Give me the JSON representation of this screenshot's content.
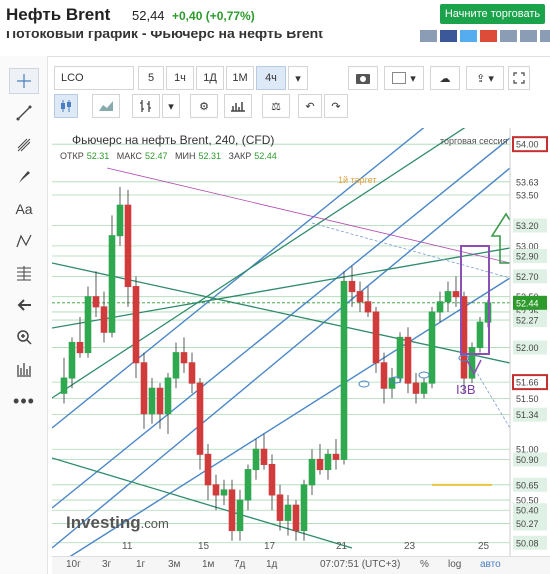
{
  "header": {
    "title": "Нефть Brent",
    "price": "52,44",
    "change": "+0,40 (+0,77%)",
    "trade_button": "Начните торговать",
    "subtitle": "Потоковый график - Фьючерс на нефть Brent"
  },
  "toolbar": {
    "symbol": "LCO",
    "intervals": [
      "5",
      "1ч",
      "1Д",
      "1М",
      "4ч"
    ],
    "selected_interval": "4ч"
  },
  "chart": {
    "legend_title": "Фьючерс на нефть Brent, 240, (CFD)",
    "session_label": "торговая сессия",
    "ohlc": {
      "open_label": "ОТКР",
      "open": "52.31",
      "high_label": "МАКС",
      "high": "52.47",
      "low_label": "МИН",
      "low": "52.31",
      "close_label": "ЗАКР",
      "close": "52.44"
    },
    "target_label": "1й таргет",
    "wave_label": "I3B",
    "watermark": "Investing",
    "watermark_suffix": ".com",
    "current_price_tag": "52.44",
    "boxed_levels": [
      "54.00",
      "51.66"
    ],
    "highlight_levels": [
      "53.20",
      "52.90",
      "52.70",
      "52.35",
      "52.27",
      "52.00",
      "51.34",
      "50.90",
      "50.65",
      "50.40",
      "50.27",
      "50.08"
    ],
    "plain_ticks": [
      "53.63",
      "53.50",
      "53.00",
      "52.50",
      "51.50",
      "51.00",
      "50.50"
    ]
  },
  "chart_data": {
    "type": "candlestick",
    "ylim": [
      49.95,
      54.1
    ],
    "candles": [
      {
        "o": 51.55,
        "h": 51.9,
        "l": 51.45,
        "c": 51.7
      },
      {
        "o": 51.7,
        "h": 52.1,
        "l": 51.6,
        "c": 52.05
      },
      {
        "o": 52.05,
        "h": 52.3,
        "l": 51.9,
        "c": 51.95
      },
      {
        "o": 51.95,
        "h": 52.6,
        "l": 51.9,
        "c": 52.5
      },
      {
        "o": 52.5,
        "h": 52.75,
        "l": 52.3,
        "c": 52.4
      },
      {
        "o": 52.4,
        "h": 52.55,
        "l": 52.05,
        "c": 52.15
      },
      {
        "o": 52.15,
        "h": 53.3,
        "l": 52.1,
        "c": 53.1
      },
      {
        "o": 53.1,
        "h": 53.58,
        "l": 53.0,
        "c": 53.4
      },
      {
        "o": 53.4,
        "h": 53.55,
        "l": 52.4,
        "c": 52.6
      },
      {
        "o": 52.6,
        "h": 52.7,
        "l": 51.7,
        "c": 51.85
      },
      {
        "o": 51.85,
        "h": 51.95,
        "l": 51.2,
        "c": 51.35
      },
      {
        "o": 51.35,
        "h": 51.7,
        "l": 51.25,
        "c": 51.6
      },
      {
        "o": 51.6,
        "h": 51.65,
        "l": 51.2,
        "c": 51.35
      },
      {
        "o": 51.35,
        "h": 51.75,
        "l": 51.15,
        "c": 51.7
      },
      {
        "o": 51.7,
        "h": 52.05,
        "l": 51.6,
        "c": 51.95
      },
      {
        "o": 51.95,
        "h": 52.1,
        "l": 51.75,
        "c": 51.85
      },
      {
        "o": 51.85,
        "h": 51.95,
        "l": 51.55,
        "c": 51.65
      },
      {
        "o": 51.65,
        "h": 51.7,
        "l": 50.8,
        "c": 50.95
      },
      {
        "o": 50.95,
        "h": 51.05,
        "l": 50.5,
        "c": 50.65
      },
      {
        "o": 50.65,
        "h": 50.75,
        "l": 50.4,
        "c": 50.55
      },
      {
        "o": 50.55,
        "h": 50.7,
        "l": 50.45,
        "c": 50.6
      },
      {
        "o": 50.6,
        "h": 50.7,
        "l": 50.1,
        "c": 50.2
      },
      {
        "o": 50.2,
        "h": 50.6,
        "l": 50.1,
        "c": 50.5
      },
      {
        "o": 50.5,
        "h": 50.85,
        "l": 50.4,
        "c": 50.8
      },
      {
        "o": 50.8,
        "h": 51.1,
        "l": 50.7,
        "c": 51.0
      },
      {
        "o": 51.0,
        "h": 51.15,
        "l": 50.8,
        "c": 50.85
      },
      {
        "o": 50.85,
        "h": 50.95,
        "l": 50.4,
        "c": 50.55
      },
      {
        "o": 50.55,
        "h": 50.65,
        "l": 50.2,
        "c": 50.3
      },
      {
        "o": 50.3,
        "h": 50.55,
        "l": 50.15,
        "c": 50.45
      },
      {
        "o": 50.45,
        "h": 50.5,
        "l": 50.1,
        "c": 50.2
      },
      {
        "o": 50.2,
        "h": 50.7,
        "l": 50.1,
        "c": 50.65
      },
      {
        "o": 50.65,
        "h": 51.0,
        "l": 50.55,
        "c": 50.9
      },
      {
        "o": 50.9,
        "h": 51.05,
        "l": 50.75,
        "c": 50.8
      },
      {
        "o": 50.8,
        "h": 51.0,
        "l": 50.7,
        "c": 50.95
      },
      {
        "o": 50.95,
        "h": 51.1,
        "l": 50.8,
        "c": 50.9
      },
      {
        "o": 50.9,
        "h": 52.75,
        "l": 50.85,
        "c": 52.65
      },
      {
        "o": 52.65,
        "h": 52.8,
        "l": 52.4,
        "c": 52.55
      },
      {
        "o": 52.55,
        "h": 52.65,
        "l": 52.35,
        "c": 52.45
      },
      {
        "o": 52.45,
        "h": 52.6,
        "l": 52.3,
        "c": 52.35
      },
      {
        "o": 52.35,
        "h": 52.4,
        "l": 51.75,
        "c": 51.85
      },
      {
        "o": 51.85,
        "h": 51.95,
        "l": 51.45,
        "c": 51.6
      },
      {
        "o": 51.6,
        "h": 51.8,
        "l": 51.5,
        "c": 51.7
      },
      {
        "o": 51.7,
        "h": 52.15,
        "l": 51.65,
        "c": 52.1
      },
      {
        "o": 52.1,
        "h": 52.2,
        "l": 51.55,
        "c": 51.65
      },
      {
        "o": 51.65,
        "h": 51.75,
        "l": 51.45,
        "c": 51.55
      },
      {
        "o": 51.55,
        "h": 51.7,
        "l": 51.5,
        "c": 51.65
      },
      {
        "o": 51.65,
        "h": 52.4,
        "l": 51.6,
        "c": 52.35
      },
      {
        "o": 52.35,
        "h": 52.55,
        "l": 52.25,
        "c": 52.45
      },
      {
        "o": 52.45,
        "h": 52.65,
        "l": 52.35,
        "c": 52.55
      },
      {
        "o": 52.55,
        "h": 52.7,
        "l": 52.4,
        "c": 52.5
      },
      {
        "o": 52.5,
        "h": 52.55,
        "l": 51.55,
        "c": 51.7
      },
      {
        "o": 51.7,
        "h": 52.05,
        "l": 51.65,
        "c": 52.0
      },
      {
        "o": 52.0,
        "h": 52.3,
        "l": 51.95,
        "c": 52.25
      },
      {
        "o": 52.25,
        "h": 52.47,
        "l": 52.2,
        "c": 52.44
      }
    ]
  },
  "footer": {
    "x_labels": [
      "11",
      "15",
      "17",
      "21",
      "23",
      "25"
    ],
    "ranges": [
      "10г",
      "3г",
      "1г",
      "3м",
      "1м",
      "7д",
      "1д"
    ],
    "time": "07:07:51 (UTC+3)",
    "percent": "%",
    "log": "log",
    "auto": "авто"
  }
}
